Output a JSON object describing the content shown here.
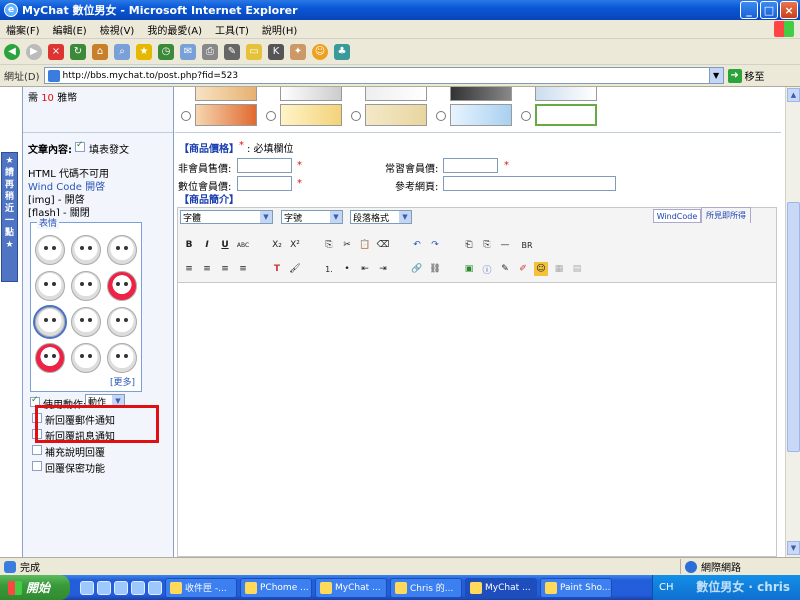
{
  "window": {
    "title": "MyChat 數位男女 - Microsoft Internet Explorer",
    "min": "_",
    "max": "□",
    "close": "×"
  },
  "menu": [
    "檔案(F)",
    "編輯(E)",
    "檢視(V)",
    "我的最愛(A)",
    "工具(T)",
    "說明(H)"
  ],
  "address": {
    "label": "網址(D)",
    "url": "http://bbs.mychat.to/post.php?fid=523",
    "go_label": "移至"
  },
  "left": {
    "price_need": "需",
    "price_amount": "10",
    "price_unit": "雅幣",
    "content_label": "文章內容:",
    "wysiwyg_label": "填表發文",
    "html_status": "HTML 代碼不可用",
    "windcode_label": "Wind Code",
    "windcode_status": "開啓",
    "img_status": "[img] - 開啓",
    "flash_status": "[flash] - 關閉",
    "emoji_title": "表情",
    "emoji_more": "[更多]",
    "use_action_label": "使用動作:",
    "action_select": "動作",
    "options": [
      "新回覆郵件通知",
      "新回覆訊息通知",
      "補充說明回覆",
      "回覆保密功能"
    ],
    "side_tab": [
      "★",
      "請",
      "再",
      "稍",
      "近",
      "一",
      "點",
      "★"
    ]
  },
  "right": {
    "price_title": "【商品價格】",
    "required_star": "*",
    "required_note": ": 必填欄位",
    "nonmember_price": "非會員售價:",
    "member_price": "數位會員價:",
    "regular_price": "常習會員價:",
    "reference_url": "參考網頁:",
    "intro_title": "【商品簡介】",
    "font_select": "字體",
    "size_select": "字號",
    "format_select": "段落格式",
    "tab_windcode": "WindCode",
    "tab_wysiwyg": "所見即所得",
    "tools_row1": [
      "B",
      "I",
      "U",
      "ABC",
      "X₂",
      "X²",
      "⎘",
      "✂",
      "📋",
      "⌫",
      "↶",
      "↷",
      "⎗",
      "⎘",
      "—",
      "BR"
    ],
    "tools_row2": [
      "≡",
      "≡",
      "≡",
      "≡",
      "T",
      "🖌",
      "1.",
      "•",
      "⇤",
      "⇥",
      "🔗",
      "⛓",
      "▣",
      "ⓘ",
      "✎",
      "✐",
      "☺",
      "▦",
      "▤"
    ]
  },
  "status": {
    "text": "完成",
    "zone": "網際網路"
  },
  "taskbar": {
    "start": "開始",
    "tasks": [
      "收件匣 -...",
      "PChome ...",
      "MyChat ...",
      "Chris 的...",
      "MyChat ...",
      "Paint Sho..."
    ],
    "tray_lang": "CH",
    "watermark": "數位男女 · chris"
  },
  "colors": {
    "required": "#e01010",
    "highlight_box": "#e01010",
    "title_blue": "#1a3fb0"
  }
}
